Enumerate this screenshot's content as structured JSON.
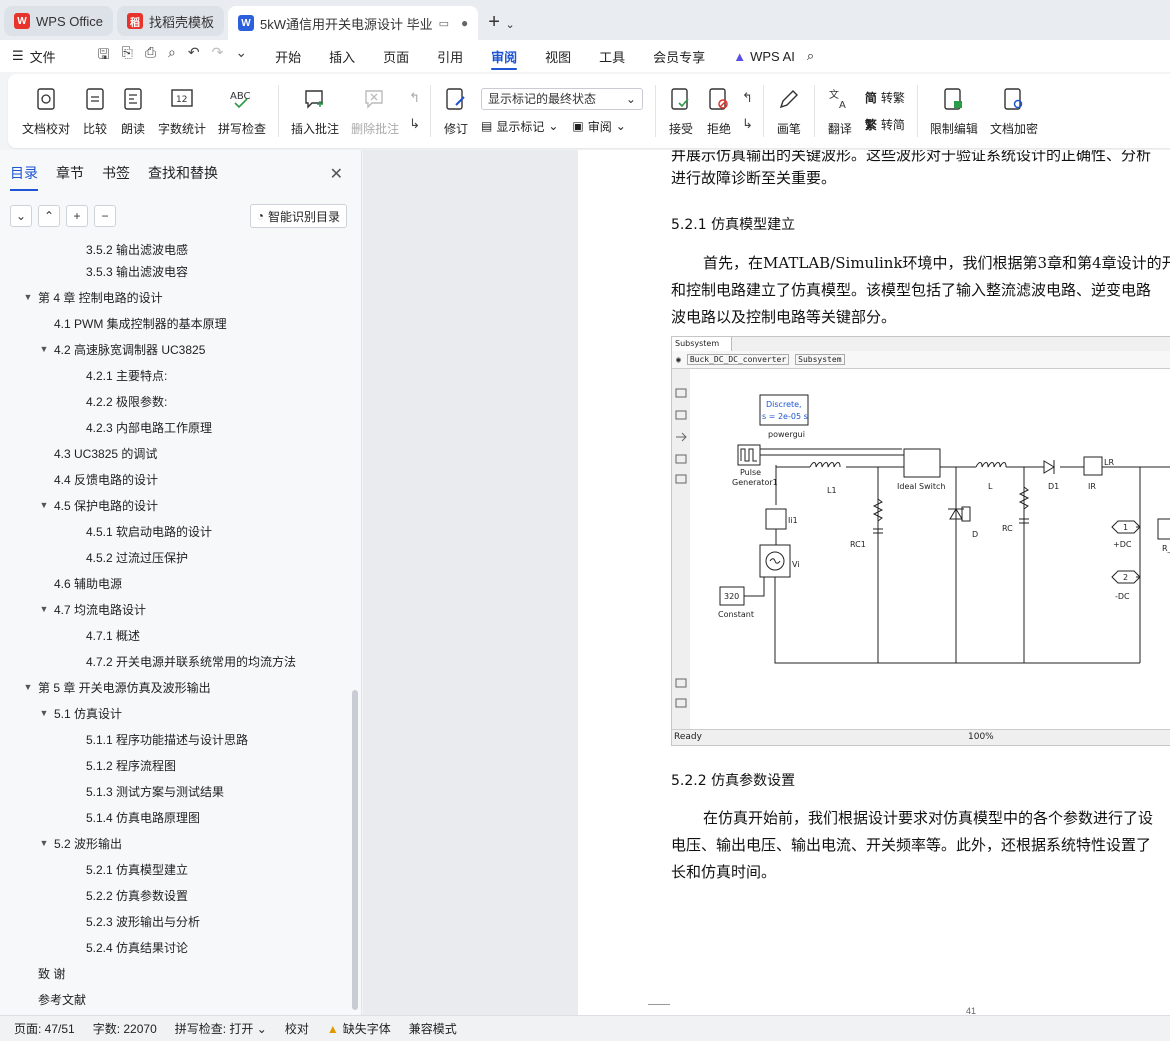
{
  "tabs": [
    {
      "label": "WPS Office",
      "logo": "W",
      "color": "#e8332d"
    },
    {
      "label": "找稻壳模板",
      "logo": "稻",
      "color": "#e8332d"
    },
    {
      "label": "5kW通信用开关电源设计 毕业",
      "logo": "W",
      "color": "#2b5fdc"
    }
  ],
  "menubar": {
    "file": "文件",
    "items": [
      "开始",
      "插入",
      "页面",
      "引用",
      "审阅",
      "视图",
      "工具",
      "会员专享"
    ],
    "active": "审阅",
    "wps_ai": "WPS AI"
  },
  "ribbon": {
    "doc_check": "文档校对",
    "compare": "比较",
    "read_aloud": "朗读",
    "word_count": "字数统计",
    "spell_check": "拼写检查",
    "insert_comment": "插入批注",
    "delete_comment": "删除批注",
    "revise": "修订",
    "markup_mode": "显示标记的最终状态",
    "show_markup": "显示标记",
    "review": "审阅",
    "accept": "接受",
    "reject": "拒绝",
    "pen": "画笔",
    "translate": "翻译",
    "to_traditional": "转繁",
    "to_simplified": "转简",
    "restrict_edit": "限制编辑",
    "encrypt": "文档加密"
  },
  "panel": {
    "tabs": [
      "目录",
      "章节",
      "书签",
      "查找和替换"
    ],
    "active_tab": "目录",
    "smart_toc": "智能识别目录"
  },
  "toc": [
    {
      "level": 3,
      "text": "3.5.2  输出滤波电感",
      "caret": ""
    },
    {
      "level": 3,
      "text": "3.5.3  输出滤波电容",
      "caret": ""
    },
    {
      "level": 1,
      "text": "第 4 章  控制电路的设计",
      "caret": "▼"
    },
    {
      "level": 2,
      "text": "4.1 PWM 集成控制器的基本原理",
      "caret": ""
    },
    {
      "level": 2,
      "text": "4.2  高速脉宽调制器 UC3825",
      "caret": "▼"
    },
    {
      "level": 3,
      "text": "4.2.1  主要特点:",
      "caret": ""
    },
    {
      "level": 3,
      "text": "4.2.2  极限参数:",
      "caret": ""
    },
    {
      "level": 3,
      "text": "4.2.3  内部电路工作原理",
      "caret": ""
    },
    {
      "level": 2,
      "text": "4.3    UC3825 的调试",
      "caret": ""
    },
    {
      "level": 2,
      "text": "4.4  反馈电路的设计",
      "caret": ""
    },
    {
      "level": 2,
      "text": "4.5 保护电路的设计",
      "caret": "▼"
    },
    {
      "level": 3,
      "text": "4.5.1 软启动电路的设计",
      "caret": ""
    },
    {
      "level": 3,
      "text": "4.5.2 过流过压保护",
      "caret": ""
    },
    {
      "level": 2,
      "text": "4.6  辅助电源",
      "caret": ""
    },
    {
      "level": 2,
      "text": "4.7  均流电路设计",
      "caret": "▼"
    },
    {
      "level": 3,
      "text": "4.7.1  概述",
      "caret": ""
    },
    {
      "level": 3,
      "text": "4.7.2  开关电源并联系统常用的均流方法",
      "caret": ""
    },
    {
      "level": 1,
      "text": "第 5 章  开关电源仿真及波形输出",
      "caret": "▼"
    },
    {
      "level": 2,
      "text": "5.1 仿真设计",
      "caret": "▼"
    },
    {
      "level": 3,
      "text": "5.1.1 程序功能描述与设计思路",
      "caret": ""
    },
    {
      "level": 3,
      "text": "5.1.2 程序流程图",
      "caret": ""
    },
    {
      "level": 3,
      "text": "5.1.3 测试方案与测试结果",
      "caret": ""
    },
    {
      "level": 3,
      "text": "5.1.4 仿真电路原理图",
      "caret": ""
    },
    {
      "level": 2,
      "text": "5.2  波形输出",
      "caret": "▼"
    },
    {
      "level": 3,
      "text": "5.2.1  仿真模型建立",
      "caret": ""
    },
    {
      "level": 3,
      "text": "5.2.2  仿真参数设置",
      "caret": ""
    },
    {
      "level": 3,
      "text": "5.2.3  波形输出与分析",
      "caret": ""
    },
    {
      "level": 3,
      "text": "5.2.4  仿真结果讨论",
      "caret": ""
    },
    {
      "level": 1,
      "text": "致    谢",
      "caret": ""
    },
    {
      "level": 1,
      "text": "参考文献",
      "caret": ""
    }
  ],
  "doc": {
    "line0": "并展示仿真输出的关键波形。这些波形对于验证系统设计的正确性、分析",
    "line1": "进行故障诊断至关重要。",
    "h1": "5.2.1  仿真模型建立",
    "p1a": "首先，在MATLAB/Simulink环境中，我们根据第3章和第4章设计的开",
    "p1b": "和控制电路建立了仿真模型。该模型包括了输入整流滤波电路、逆变电路",
    "p1c": "波电路以及控制电路等关键部分。",
    "h2": "5.2.2  仿真参数设置",
    "p2a": "在仿真开始前，我们根据设计要求对仿真模型中的各个参数进行了设",
    "p2b": "电压、输出电压、输出电流、开关频率等。此外，还根据系统特性设置了",
    "p2c": "长和仿真时间。",
    "page_num": "41"
  },
  "sim": {
    "window_title": "Subsystem",
    "path_root": "Buck_DC_DC_converter",
    "path_sub": "Subsystem",
    "status_ready": "Ready",
    "status_zoom": "100%",
    "powergui_line1": "Discrete,",
    "powergui_line2": "s = 2e-05 s",
    "powergui": "powergui",
    "pulse": "Pulse",
    "generator": "Generator1",
    "l1": "L1",
    "ideal_switch": "Ideal Switch",
    "l": "L",
    "d1": "D1",
    "ir": "IR",
    "lr": "LR",
    "ii1": "Ii1",
    "rc1": "RC1",
    "d": "D",
    "rc": "RC",
    "vi": "Vi",
    "port1": "1",
    "port2": "2",
    "plus_dc": "+DC",
    "minus_dc": "-DC",
    "r_u": "R_U",
    "constant_val": "320",
    "constant": "Constant"
  },
  "status": {
    "page": "页面: 47/51",
    "words": "字数: 22070",
    "spell": "拼写检查: 打开",
    "proof": "校对",
    "missing_font": "缺失字体",
    "compat": "兼容模式"
  }
}
